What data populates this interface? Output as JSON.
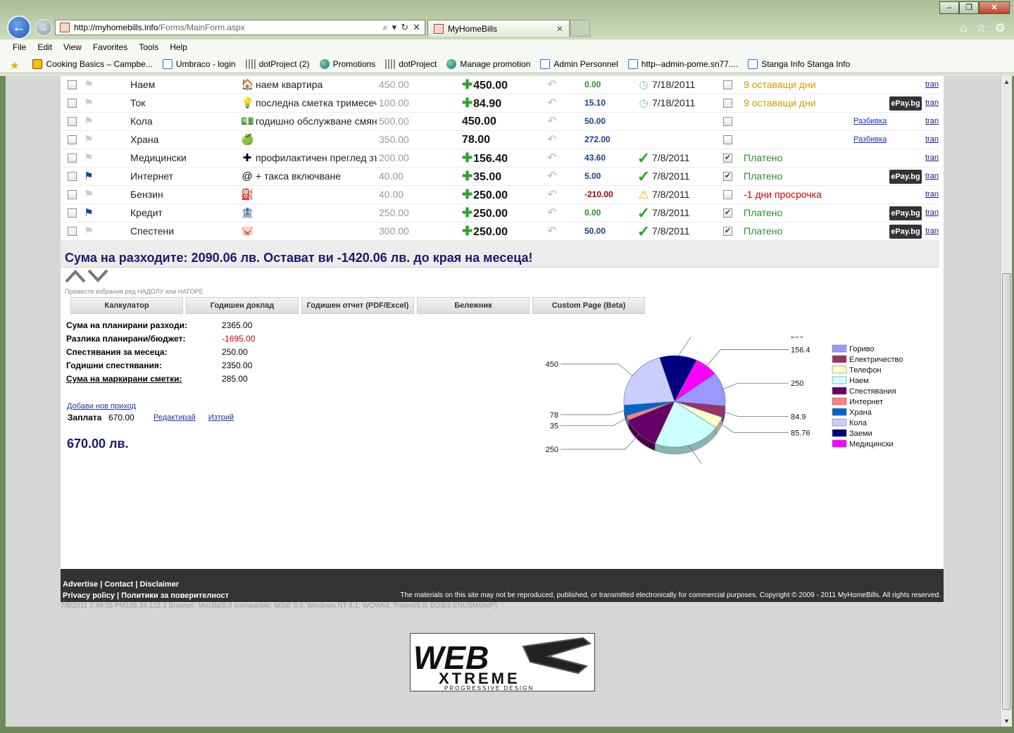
{
  "browser": {
    "url_host": "http://myhomebills.info",
    "url_path": "/Forms/MainForm.aspx",
    "tab_title": "MyHomeBills",
    "menu": [
      "File",
      "Edit",
      "View",
      "Favorites",
      "Tools",
      "Help"
    ],
    "favorites": [
      {
        "label": "Cooking Basics – Campbe...",
        "icon": "yellow-feed-icon"
      },
      {
        "label": "Umbraco - login",
        "icon": "page-icon"
      },
      {
        "label": "dotProject (2)",
        "icon": "grid-icon"
      },
      {
        "label": "Promotions",
        "icon": "globe-icon"
      },
      {
        "label": "dotProject",
        "icon": "grid-icon"
      },
      {
        "label": "Manage promotion",
        "icon": "globe-icon"
      },
      {
        "label": "Admin Personnel",
        "icon": "page-icon"
      },
      {
        "label": "http--admin-pome.sn77....",
        "icon": "page-icon"
      },
      {
        "label": "Stanga Info  Stanga Info",
        "icon": "page-icon"
      }
    ]
  },
  "bills": [
    {
      "paid_selected": false,
      "flag": false,
      "category": "Наем",
      "icon": "🏠",
      "description": "наем квартира",
      "planned": "450.00",
      "amount": "450.00",
      "plus": true,
      "diff": "0.00",
      "diff_color": "green",
      "status_icon": "clock",
      "date": "7/18/2011",
      "paid": false,
      "status": "9 оставащи дни",
      "status_color": "orange",
      "epay": false,
      "split": false,
      "tran": "tran"
    },
    {
      "paid_selected": false,
      "flag": false,
      "category": "Ток",
      "icon": "💡",
      "description": "последна сметка тримесечие",
      "planned": "100.00",
      "amount": "84.90",
      "plus": true,
      "diff": "15.10",
      "diff_color": "blue",
      "status_icon": "clock",
      "date": "7/18/2011",
      "paid": false,
      "status": "9 оставащи дни",
      "status_color": "orange",
      "epay": true,
      "split": false,
      "tran": "tran"
    },
    {
      "paid_selected": false,
      "flag": false,
      "category": "Кола",
      "icon": "💵",
      "description": "годишно обслужване смяна",
      "planned": "500.00",
      "amount": "450.00",
      "plus": false,
      "diff": "50.00",
      "diff_color": "blue",
      "status_icon": "",
      "date": "",
      "paid": false,
      "status": "",
      "status_color": "",
      "epay": false,
      "split": true,
      "tran": "tran"
    },
    {
      "paid_selected": false,
      "flag": false,
      "category": "Храна",
      "icon": "🍏",
      "description": "",
      "planned": "350.00",
      "amount": "78.00",
      "plus": false,
      "diff": "272.00",
      "diff_color": "blue",
      "status_icon": "",
      "date": "",
      "paid": false,
      "status": "",
      "status_color": "",
      "epay": false,
      "split": true,
      "tran": "tran"
    },
    {
      "paid_selected": false,
      "flag": false,
      "category": "Медицински",
      "icon": "✚",
      "description": "профилактичен преглед зъболекар",
      "planned": "200.00",
      "amount": "156.40",
      "plus": true,
      "diff": "43.60",
      "diff_color": "blue",
      "status_icon": "check",
      "date": "7/8/2011",
      "paid": true,
      "status": "Платено",
      "status_color": "green",
      "epay": false,
      "split": false,
      "tran": "tran"
    },
    {
      "paid_selected": false,
      "flag": true,
      "category": "Интернет",
      "icon": "@",
      "description": "+ такса включване",
      "planned": "40.00",
      "amount": "35.00",
      "plus": true,
      "diff": "5.00",
      "diff_color": "blue",
      "status_icon": "check",
      "date": "7/8/2011",
      "paid": true,
      "status": "Платено",
      "status_color": "green",
      "epay": true,
      "split": false,
      "tran": "tran"
    },
    {
      "paid_selected": false,
      "flag": false,
      "category": "Бензин",
      "icon": "⛽",
      "description": "",
      "planned": "40.00",
      "amount": "250.00",
      "plus": true,
      "diff": "-210.00",
      "diff_color": "red",
      "status_icon": "warn",
      "date": "7/8/2011",
      "paid": false,
      "status": "-1 дни просрочка",
      "status_color": "red",
      "epay": false,
      "split": false,
      "tran": "tran"
    },
    {
      "paid_selected": false,
      "flag": true,
      "category": "Кредит",
      "icon": "🏦",
      "description": "",
      "planned": "250.00",
      "amount": "250.00",
      "plus": true,
      "diff": "0.00",
      "diff_color": "green",
      "status_icon": "check",
      "date": "7/8/2011",
      "paid": true,
      "status": "Платено",
      "status_color": "green",
      "epay": true,
      "split": false,
      "tran": "tran"
    },
    {
      "paid_selected": false,
      "flag": false,
      "category": "Спестени",
      "icon": "🐷",
      "description": "",
      "planned": "300.00",
      "amount": "250.00",
      "plus": true,
      "diff": "50.00",
      "diff_color": "blue",
      "status_icon": "check",
      "date": "7/8/2011",
      "paid": true,
      "status": "Платено",
      "status_color": "green",
      "epay": true,
      "split": false,
      "tran": "tran"
    }
  ],
  "labels": {
    "epay": "ePay.bg",
    "split": "Разбивка",
    "summary": "Сума на разходите: 2090.06 лв. Остават ви -1420.06 лв. до края на месеца!",
    "move_hint": "Премести избрания ред НАДОЛУ или НАГОРЕ",
    "add_income": "Добави нов приход",
    "edit": "Редактирай",
    "delete": "Изтрий",
    "income_total": "670.00 лв."
  },
  "toolbar_buttons": [
    "Калкулатор",
    "Годишен доклад",
    "Годишен отчет (PDF/Excel)",
    "Бележник",
    "Custom Page (Beta)"
  ],
  "stats": [
    {
      "label": "Сума на планирани разходи:",
      "value": "2365.00",
      "color": "",
      "underline": false
    },
    {
      "label": "Разлика планирани/бюджет:",
      "value": "-1695.00",
      "color": "red",
      "underline": false
    },
    {
      "label": "Спестявания за месеца:",
      "value": "250.00",
      "color": "",
      "underline": false
    },
    {
      "label": "Годишни спестявания:",
      "value": "2350.00",
      "color": "",
      "underline": false
    },
    {
      "label": "Сума на маркирани сметки:",
      "value": "285.00",
      "color": "",
      "underline": true
    }
  ],
  "income": {
    "label": "Заплата",
    "value": "670.00"
  },
  "chart_data": {
    "type": "pie",
    "title": "",
    "slices": [
      {
        "label": "Медицински",
        "value": 156.4,
        "color": "#ff00ff"
      },
      {
        "label": "Горивo",
        "value": 250,
        "color": "#9999ff"
      },
      {
        "label": "Електричество",
        "value": 84.9,
        "color": "#993366"
      },
      {
        "label": "Телефон",
        "value": 85.76,
        "color": "#ffffcc"
      },
      {
        "label": "Наем",
        "value": 450,
        "color": "#ccffff"
      },
      {
        "label": "Спестявания",
        "value": 250,
        "color": "#660066"
      },
      {
        "label": "Интернет",
        "value": 35,
        "color": "#ff8080"
      },
      {
        "label": "Храна",
        "value": 78,
        "color": "#0066cc"
      },
      {
        "label": "Кола",
        "value": 450,
        "color": "#ccccff"
      },
      {
        "label": "Заеми",
        "value": 250,
        "color": "#000080"
      }
    ],
    "legend": [
      {
        "label": "Гориво",
        "color": "#9999ff"
      },
      {
        "label": "Електричество",
        "color": "#993366"
      },
      {
        "label": "Телефон",
        "color": "#ffffcc"
      },
      {
        "label": "Наем",
        "color": "#ccffff"
      },
      {
        "label": "Спестявания",
        "color": "#660066"
      },
      {
        "label": "Интернет",
        "color": "#ff8080"
      },
      {
        "label": "Храна",
        "color": "#0066cc"
      },
      {
        "label": "Кола",
        "color": "#ccccff"
      },
      {
        "label": "Заеми",
        "color": "#000080"
      },
      {
        "label": "Медицински",
        "color": "#ff00ff"
      }
    ],
    "data_labels": [
      "156.4",
      "250",
      "84.9",
      "85.76",
      "450",
      "250",
      "35",
      "78",
      "450",
      "250"
    ],
    "legend_position": "right"
  },
  "footer": {
    "links": "Advertise | Contact | Disclaimer",
    "links2": "Privacy policy | Политики за поверителност",
    "copyright": "The materials on this site may not be reproduced, published, or transmitted electronically for commercial purposes. Copyright © 2009 - 2011 MyHomeBills. All rights reserved.",
    "browser_info": "7/8/2011 2:49:55 PM195.34.122.3 Browser: Mozilla/5.0 (compatible; MSIE 9.0; Windows NT 6.1; WOW64; Trident/5.0; BOIE9;ENUSMSNIP)"
  },
  "logo": {
    "text": "WEB XTREME",
    "sub": "PROGRESSIVE DESIGN"
  }
}
